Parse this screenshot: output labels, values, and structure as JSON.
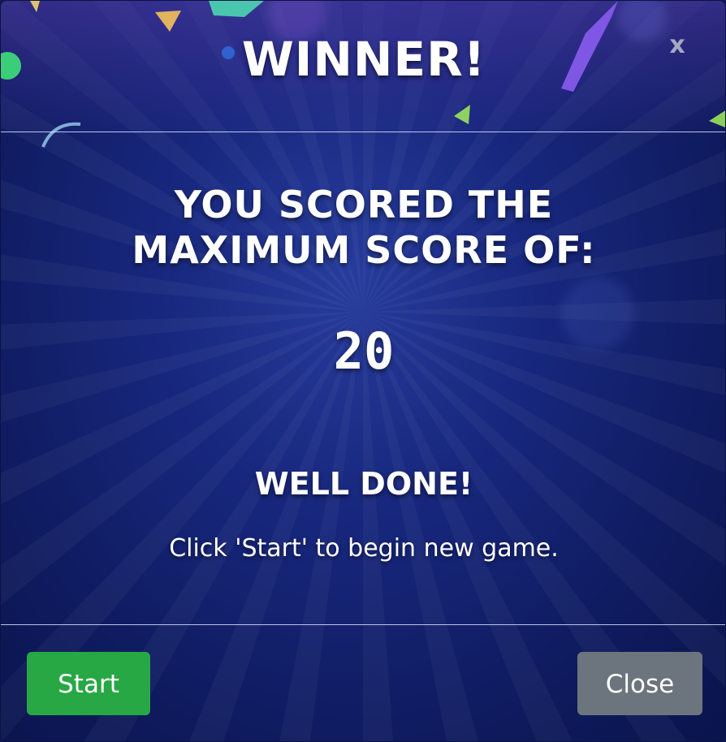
{
  "modal": {
    "title": "WINNER!",
    "close_icon": "close-x-icon",
    "close_glyph": "x"
  },
  "body": {
    "score_line_1": "YOU SCORED THE",
    "score_line_2": "MAXIMUM SCORE OF:",
    "score_value": "20",
    "congrats": "WELL DONE!",
    "instruction": "Click 'Start' to begin new game."
  },
  "footer": {
    "start_label": "Start",
    "close_label": "Close"
  },
  "colors": {
    "background": "#17287f",
    "start_button": "#28a745",
    "close_button": "#6c757d",
    "text": "#ffffff"
  }
}
